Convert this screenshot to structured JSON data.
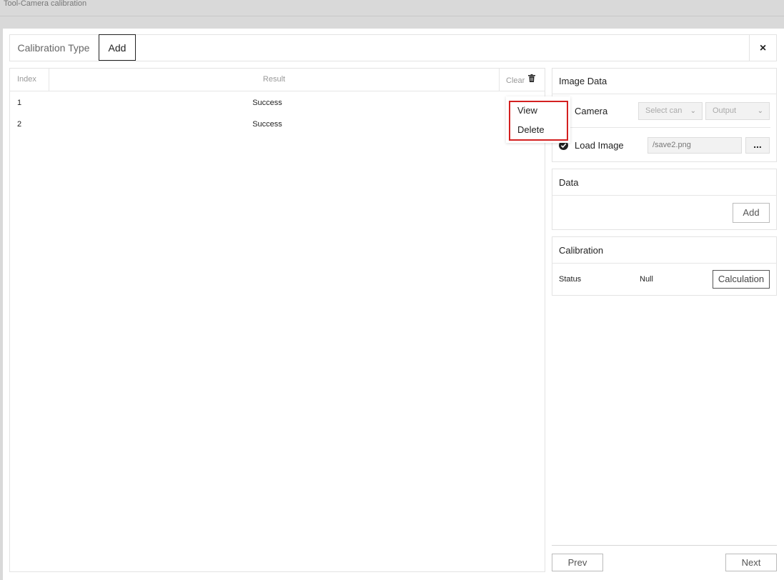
{
  "window": {
    "title": "Tool-Camera calibration"
  },
  "header": {
    "tab_calibration_type": "Calibration Type",
    "tab_add": "Add",
    "close_icon": "×"
  },
  "table": {
    "col_index": "Index",
    "col_result": "Result",
    "clear_label": "Clear",
    "rows": [
      {
        "index": "1",
        "result": "Success"
      },
      {
        "index": "2",
        "result": "Success"
      }
    ]
  },
  "context_menu": {
    "view": "View",
    "delete": "Delete"
  },
  "image_data": {
    "title": "Image Data",
    "camera_label": "Camera",
    "select_camera": "Select can",
    "select_output": "Output",
    "load_image_label": "Load Image",
    "image_path": "/save2.png",
    "browse": "..."
  },
  "data_section": {
    "title": "Data",
    "add_button": "Add"
  },
  "calibration": {
    "title": "Calibration",
    "status_label": "Status",
    "status_value": "Null",
    "calc_button": "Calculation"
  },
  "nav": {
    "prev": "Prev",
    "next": "Next"
  }
}
